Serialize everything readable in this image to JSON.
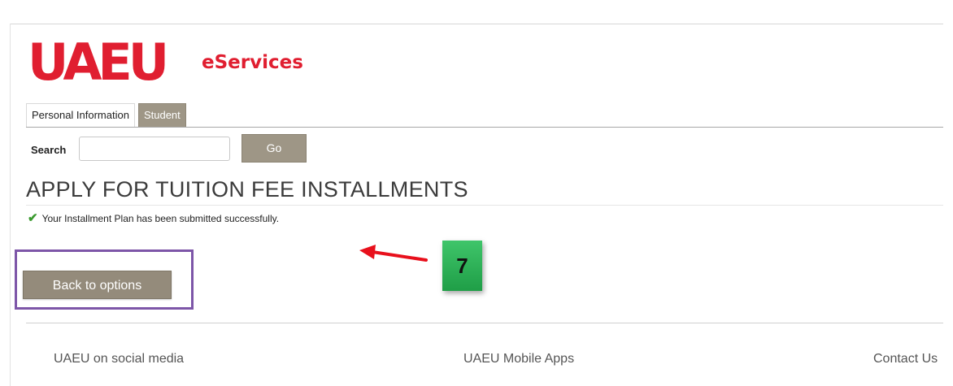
{
  "header": {
    "logo_text": "UAEU",
    "logo_subtext": "eServices"
  },
  "tabs": [
    {
      "label": "Personal Information",
      "active": false
    },
    {
      "label": "Student",
      "active": true
    }
  ],
  "search": {
    "label": "Search",
    "value": "",
    "go_label": "Go"
  },
  "main": {
    "title": "APPLY FOR TUITION FEE INSTALLMENTS",
    "success_message": "Your Installment Plan has been submitted successfully.",
    "back_button_label": "Back to options"
  },
  "annotation": {
    "step_number": "7"
  },
  "footer": {
    "social": "UAEU on social media",
    "apps": "UAEU Mobile Apps",
    "contact": "Contact Us"
  },
  "colors": {
    "brand_red": "#e01e30",
    "button_taupe": "#9e9686",
    "annotation_purple": "#7d56a8",
    "badge_green": "#2fb35a",
    "success_green": "#3a9a2f"
  },
  "icons": {
    "success": "check-icon",
    "pointer": "arrow-left-icon"
  }
}
